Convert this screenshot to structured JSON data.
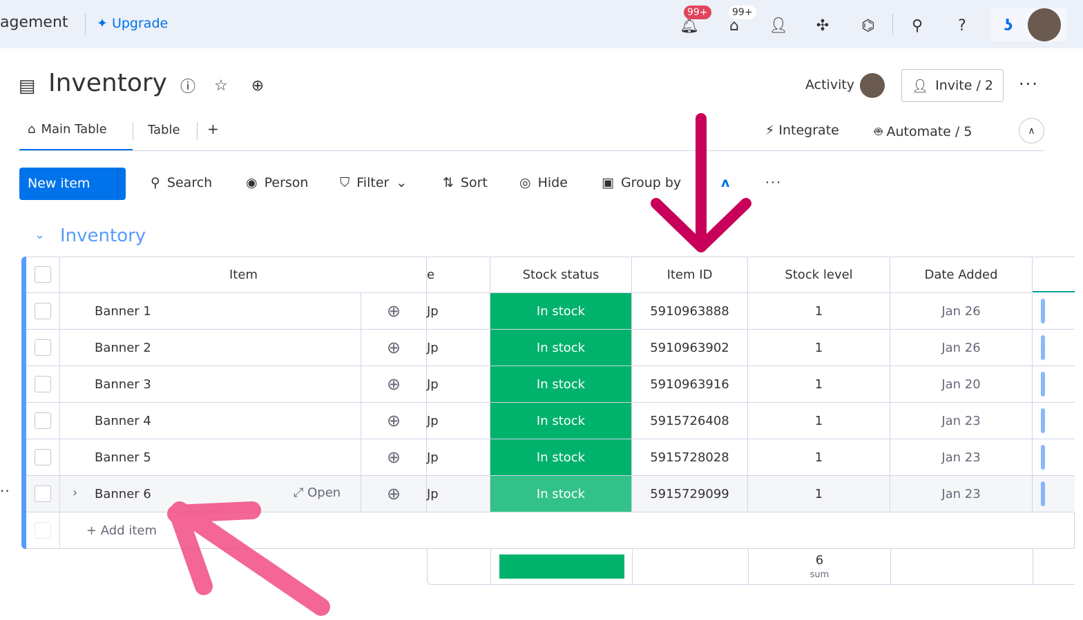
{
  "topbar": {
    "workspace_partial": "agement",
    "upgrade": "Upgrade",
    "notif_badge": "99+",
    "inbox_badge": "99+"
  },
  "board": {
    "title": "Inventory",
    "activity": "Activity",
    "invite": "Invite / 2"
  },
  "tabs": [
    {
      "label": "Main Table"
    },
    {
      "label": "Table"
    },
    {
      "label": "+"
    }
  ],
  "tab_actions": {
    "integrate": "Integrate",
    "automate": "Automate / 5"
  },
  "toolbar": {
    "new_item": "New item",
    "search": "Search",
    "person": "Person",
    "filter": "Filter",
    "sort": "Sort",
    "hide": "Hide",
    "group_by": "Group by"
  },
  "group": {
    "title": "Inventory",
    "color": "#579bfc"
  },
  "columns": {
    "item": "Item",
    "partial": "e",
    "stock_status": "Stock status",
    "item_id": "Item ID",
    "stock_level": "Stock level",
    "date_added": "Date Added"
  },
  "rows": [
    {
      "name": "Banner 1",
      "partial": "Jp",
      "status": "In stock",
      "id": "5910963888",
      "level": "1",
      "date": "Jan 26"
    },
    {
      "name": "Banner 2",
      "partial": "Jp",
      "status": "In stock",
      "id": "5910963902",
      "level": "1",
      "date": "Jan 26"
    },
    {
      "name": "Banner 3",
      "partial": "Jp",
      "status": "In stock",
      "id": "5910963916",
      "level": "1",
      "date": "Jan 20"
    },
    {
      "name": "Banner 4",
      "partial": "Jp",
      "status": "In stock",
      "id": "5915726408",
      "level": "1",
      "date": "Jan 23"
    },
    {
      "name": "Banner 5",
      "partial": "Jp",
      "status": "In stock",
      "id": "5915728028",
      "level": "1",
      "date": "Jan 23"
    },
    {
      "name": "Banner 6",
      "partial": "Jp",
      "status": "In stock",
      "id": "5915729099",
      "level": "1",
      "date": "Jan 23"
    }
  ],
  "hover_row": {
    "open": "Open"
  },
  "add_item": "+ Add item",
  "summary": {
    "sum_value": "6",
    "sum_label": "sum"
  },
  "colors": {
    "status_green": "#00b26b",
    "accent": "#0073ea",
    "annotation": "#c8005a"
  }
}
